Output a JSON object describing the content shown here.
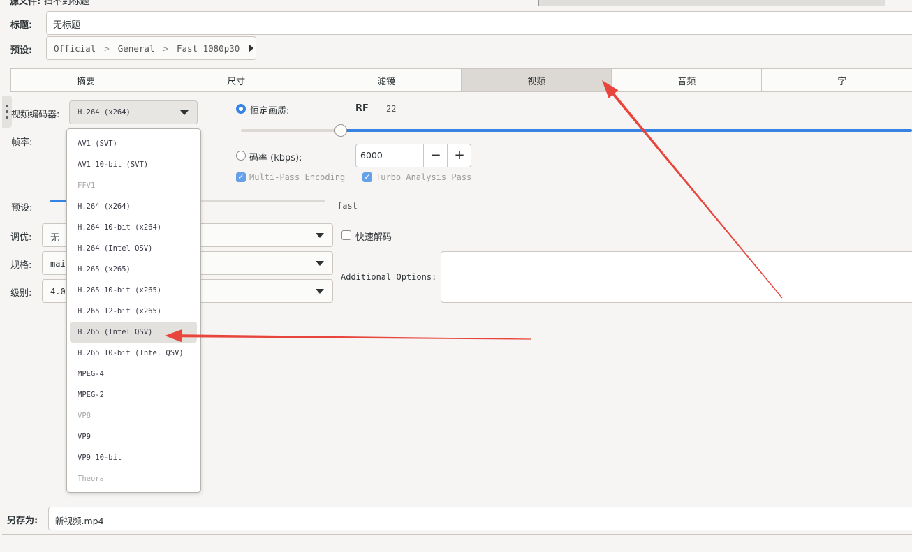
{
  "header": {
    "source_label": "源文件:",
    "source_value": "扫不到标题"
  },
  "title": {
    "label": "标题:",
    "value": "无标题"
  },
  "preset": {
    "label": "预设:",
    "path": [
      "Official",
      "General",
      "Fast 1080p30"
    ],
    "separator": ">"
  },
  "tabs": [
    {
      "label": "摘要",
      "active": false
    },
    {
      "label": "尺寸",
      "active": false
    },
    {
      "label": "滤镜",
      "active": false
    },
    {
      "label": "视频",
      "active": true
    },
    {
      "label": "音频",
      "active": false
    },
    {
      "label": "字",
      "active": false
    }
  ],
  "video": {
    "encoder_label": "视频编码器:",
    "encoder_value": "H.264 (x264)",
    "framerate_label": "帧率:",
    "quality_label": "恒定画质:",
    "rf_label": "RF",
    "rf_value": "22",
    "rf_fraction": 0.34,
    "bitrate_label": "码率 (kbps):",
    "bitrate_value": "6000",
    "minus": "−",
    "plus": "+",
    "multipass_label": "Multi-Pass Encoding",
    "turbo_label": "Turbo Analysis Pass",
    "preset_label": "预设:",
    "preset_value": "fast",
    "tune_label": "调优:",
    "tune_value": "无",
    "fastdecode_label": "快速解码",
    "profile_label": "规格:",
    "profile_value": "main",
    "level_label": "级别:",
    "level_value": "4.0",
    "additional_label": "Additional Options:",
    "additional_value": ""
  },
  "encoder_options": [
    {
      "label": "AV1 (SVT)",
      "disabled": false,
      "selected": false
    },
    {
      "label": "AV1 10-bit (SVT)",
      "disabled": false,
      "selected": false
    },
    {
      "label": "FFV1",
      "disabled": true,
      "selected": false
    },
    {
      "label": "H.264 (x264)",
      "disabled": false,
      "selected": false
    },
    {
      "label": "H.264 10-bit (x264)",
      "disabled": false,
      "selected": false
    },
    {
      "label": "H.264 (Intel QSV)",
      "disabled": false,
      "selected": false
    },
    {
      "label": "H.265 (x265)",
      "disabled": false,
      "selected": false
    },
    {
      "label": "H.265 10-bit (x265)",
      "disabled": false,
      "selected": false
    },
    {
      "label": "H.265 12-bit (x265)",
      "disabled": false,
      "selected": false
    },
    {
      "label": "H.265 (Intel QSV)",
      "disabled": false,
      "selected": true
    },
    {
      "label": "H.265 10-bit (Intel QSV)",
      "disabled": false,
      "selected": false
    },
    {
      "label": "MPEG-4",
      "disabled": false,
      "selected": false
    },
    {
      "label": "MPEG-2",
      "disabled": false,
      "selected": false
    },
    {
      "label": "VP8",
      "disabled": true,
      "selected": false
    },
    {
      "label": "VP9",
      "disabled": false,
      "selected": false
    },
    {
      "label": "VP9 10-bit",
      "disabled": false,
      "selected": false
    },
    {
      "label": "Theora",
      "disabled": true,
      "selected": false
    }
  ],
  "save": {
    "label": "另存为:",
    "value": "新视频.mp4"
  },
  "colors": {
    "accent": "#3584e4",
    "annotation_arrow": "#e8453c"
  }
}
